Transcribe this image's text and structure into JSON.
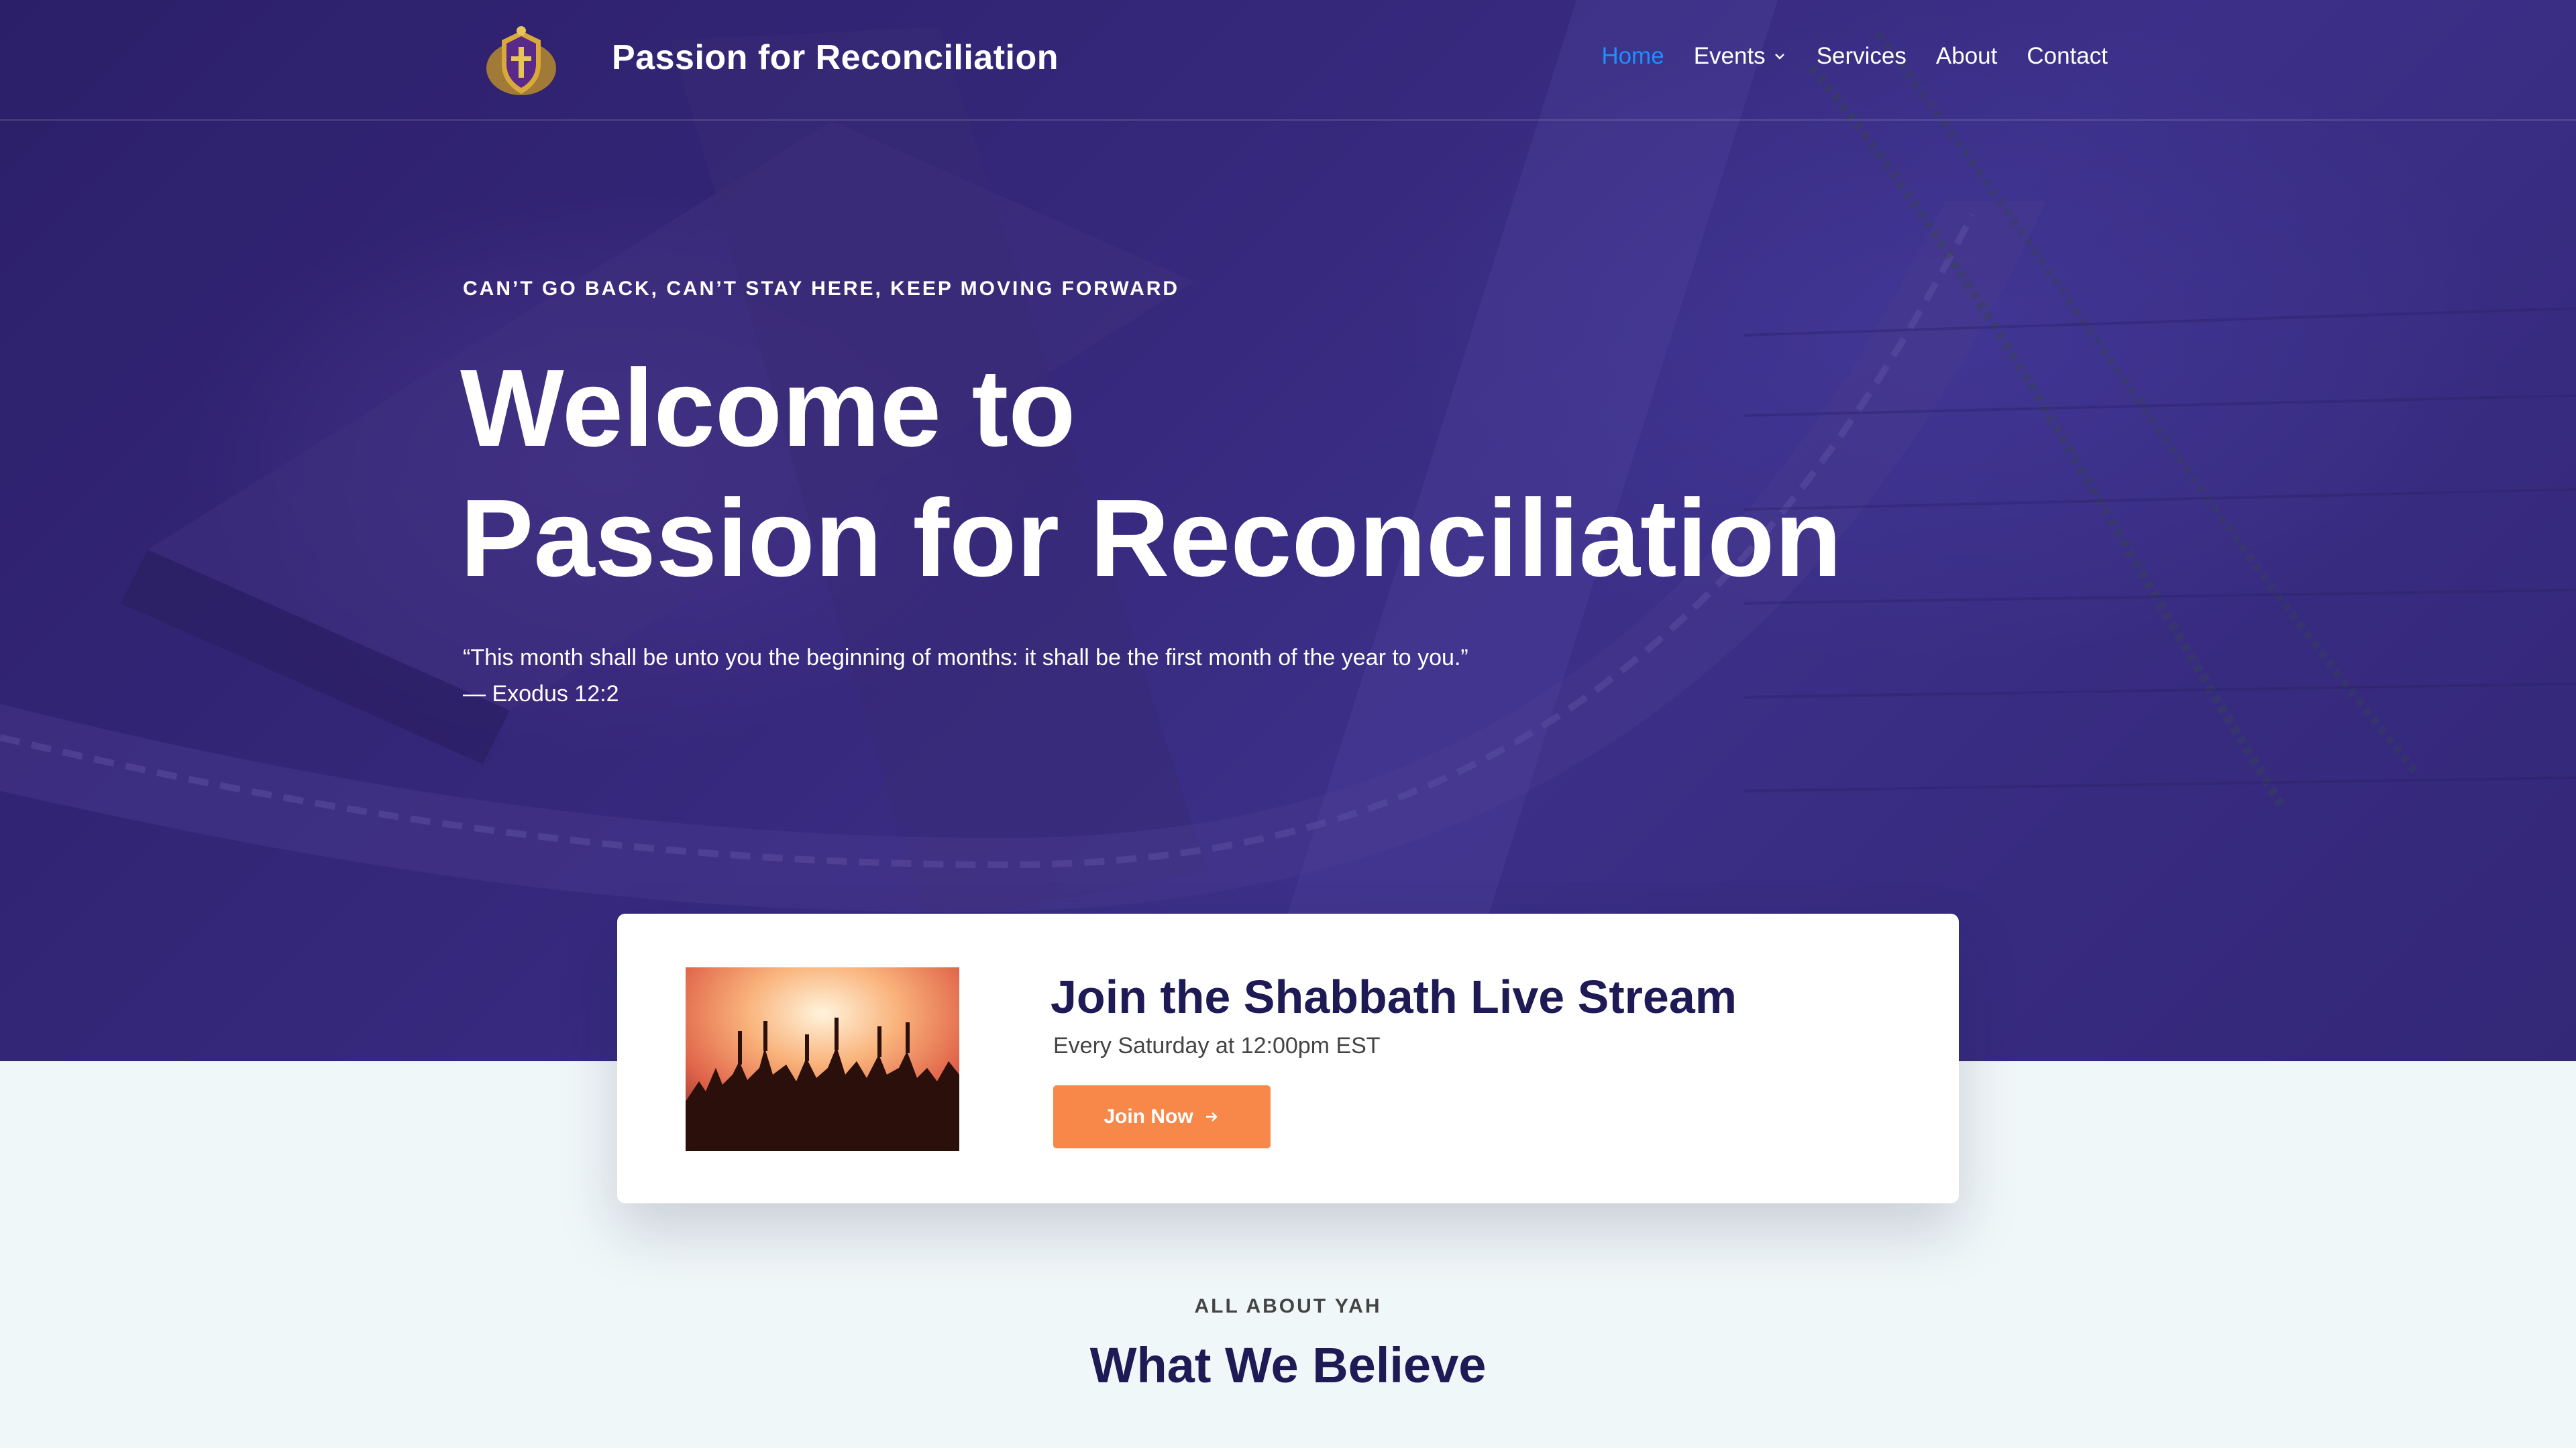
{
  "header": {
    "site_title": "Passion for Reconciliation",
    "logo_icon": "crest-logo-icon",
    "nav": [
      {
        "label": "Home",
        "active": true
      },
      {
        "label": "Events",
        "has_dropdown": true
      },
      {
        "label": "Services"
      },
      {
        "label": "About"
      },
      {
        "label": "Contact"
      }
    ]
  },
  "hero": {
    "eyebrow": "CAN’T GO BACK, CAN’T STAY HERE, KEEP MOVING FORWARD",
    "title_line1": "Welcome to",
    "title_line2": "Passion for Reconciliation",
    "quote": "“This month shall be unto you the beginning of months: it shall be the first month of the year to you.”",
    "quote_source": "— Exodus 12:2"
  },
  "livestream": {
    "title": "Join the Shabbath Live Stream",
    "schedule": "Every Saturday at 12:00pm EST",
    "button_label": "Join Now",
    "button_icon": "arrow-right-icon",
    "image": "concert-crowd-image"
  },
  "beliefs": {
    "eyebrow": "ALL ABOUT YAH",
    "title": "What We Believe"
  },
  "colors": {
    "hero_purple": "#3a2a78",
    "nav_active": "#1f8fff",
    "button_orange": "#f7884a",
    "heading_navy": "#1e1a55",
    "section_bg": "#f0f7f9"
  }
}
